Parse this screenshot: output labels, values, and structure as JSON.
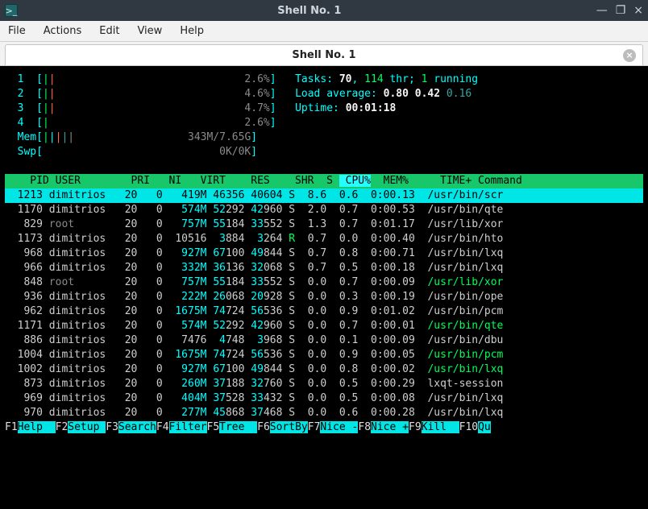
{
  "window": {
    "title": "Shell No. 1",
    "icon_text": ">_",
    "min": "—",
    "max": "❐",
    "close": "×"
  },
  "menu": [
    "File",
    "Actions",
    "Edit",
    "View",
    "Help"
  ],
  "tab": {
    "title": "Shell No. 1",
    "close": "×"
  },
  "cpu": [
    {
      "n": "1",
      "bar": "||",
      "pct": "2.6%"
    },
    {
      "n": "2",
      "bar": "||",
      "pct": "4.6%"
    },
    {
      "n": "3",
      "bar": "||",
      "pct": "4.7%"
    },
    {
      "n": "4",
      "bar": "|",
      "pct": "2.6%"
    }
  ],
  "mem": {
    "label": "Mem",
    "bar": "|||||",
    "val": "343M/7.65G"
  },
  "swp": {
    "label": "Swp",
    "bar": "",
    "val": "0K/0K"
  },
  "stats": {
    "tasks_label": "Tasks:",
    "tasks": "70",
    "thr": "114",
    "thr_label": "thr;",
    "running": "1",
    "running_label": "running",
    "load_label": "Load average:",
    "load1": "0.80",
    "load2": "0.42",
    "load3": "0.16",
    "uptime_label": "Uptime:",
    "uptime": "00:01:18"
  },
  "headers": [
    "PID",
    "USER",
    "PRI",
    "NI",
    "VIRT",
    "RES",
    "SHR",
    "S",
    "CPU%",
    "MEM%",
    "TIME+",
    "Command"
  ],
  "rows": [
    {
      "pid": "1213",
      "user": "dimitrios",
      "pri": "20",
      "ni": "0",
      "virt": "419M",
      "res": "46356",
      "shr": "40604",
      "s": "S",
      "cpu": "8.6",
      "mem": "0.6",
      "time": "0:00.13",
      "cmd": "/usr/bin/scr",
      "sel": true
    },
    {
      "pid": "1170",
      "user": "dimitrios",
      "pri": "20",
      "ni": "0",
      "virt": "574M",
      "res": "52292",
      "shr": "42960",
      "s": "S",
      "cpu": "2.0",
      "mem": "0.7",
      "time": "0:00.53",
      "cmd": "/usr/bin/qte"
    },
    {
      "pid": "829",
      "user": "root",
      "pri": "20",
      "ni": "0",
      "virt": "757M",
      "res": "55184",
      "shr": "33552",
      "s": "S",
      "cpu": "1.3",
      "mem": "0.7",
      "time": "0:01.17",
      "cmd": "/usr/lib/xor",
      "root": true
    },
    {
      "pid": "1173",
      "user": "dimitrios",
      "pri": "20",
      "ni": "0",
      "virt": "10516",
      "res": "3884",
      "shr": "3264",
      "s": "R",
      "cpu": "0.7",
      "mem": "0.0",
      "time": "0:00.40",
      "cmd": "/usr/bin/hto",
      "virt_plain": true,
      "run": true
    },
    {
      "pid": "968",
      "user": "dimitrios",
      "pri": "20",
      "ni": "0",
      "virt": "927M",
      "res": "67100",
      "shr": "49844",
      "s": "S",
      "cpu": "0.7",
      "mem": "0.8",
      "time": "0:00.71",
      "cmd": "/usr/bin/lxq"
    },
    {
      "pid": "966",
      "user": "dimitrios",
      "pri": "20",
      "ni": "0",
      "virt": "332M",
      "res": "36136",
      "shr": "32068",
      "s": "S",
      "cpu": "0.7",
      "mem": "0.5",
      "time": "0:00.18",
      "cmd": "/usr/bin/lxq"
    },
    {
      "pid": "848",
      "user": "root",
      "pri": "20",
      "ni": "0",
      "virt": "757M",
      "res": "55184",
      "shr": "33552",
      "s": "S",
      "cpu": "0.0",
      "mem": "0.7",
      "time": "0:00.09",
      "cmd": "/usr/lib/xor",
      "root": true,
      "cmdgr": true
    },
    {
      "pid": "936",
      "user": "dimitrios",
      "pri": "20",
      "ni": "0",
      "virt": "222M",
      "res": "26068",
      "shr": "20928",
      "s": "S",
      "cpu": "0.0",
      "mem": "0.3",
      "time": "0:00.19",
      "cmd": "/usr/bin/ope"
    },
    {
      "pid": "962",
      "user": "dimitrios",
      "pri": "20",
      "ni": "0",
      "virt": "1675M",
      "res": "74724",
      "shr": "56536",
      "s": "S",
      "cpu": "0.0",
      "mem": "0.9",
      "time": "0:01.02",
      "cmd": "/usr/bin/pcm"
    },
    {
      "pid": "1171",
      "user": "dimitrios",
      "pri": "20",
      "ni": "0",
      "virt": "574M",
      "res": "52292",
      "shr": "42960",
      "s": "S",
      "cpu": "0.0",
      "mem": "0.7",
      "time": "0:00.01",
      "cmd": "/usr/bin/qte",
      "cmdgr": true
    },
    {
      "pid": "886",
      "user": "dimitrios",
      "pri": "20",
      "ni": "0",
      "virt": "7476",
      "res": "4748",
      "shr": "3968",
      "s": "S",
      "cpu": "0.0",
      "mem": "0.1",
      "time": "0:00.09",
      "cmd": "/usr/bin/dbu",
      "virt_plain": true
    },
    {
      "pid": "1004",
      "user": "dimitrios",
      "pri": "20",
      "ni": "0",
      "virt": "1675M",
      "res": "74724",
      "shr": "56536",
      "s": "S",
      "cpu": "0.0",
      "mem": "0.9",
      "time": "0:00.05",
      "cmd": "/usr/bin/pcm",
      "cmdgr": true
    },
    {
      "pid": "1002",
      "user": "dimitrios",
      "pri": "20",
      "ni": "0",
      "virt": "927M",
      "res": "67100",
      "shr": "49844",
      "s": "S",
      "cpu": "0.0",
      "mem": "0.8",
      "time": "0:00.02",
      "cmd": "/usr/bin/lxq",
      "cmdgr": true
    },
    {
      "pid": "873",
      "user": "dimitrios",
      "pri": "20",
      "ni": "0",
      "virt": "260M",
      "res": "37188",
      "shr": "32760",
      "s": "S",
      "cpu": "0.0",
      "mem": "0.5",
      "time": "0:00.29",
      "cmd": "lxqt-session"
    },
    {
      "pid": "969",
      "user": "dimitrios",
      "pri": "20",
      "ni": "0",
      "virt": "404M",
      "res": "37528",
      "shr": "33432",
      "s": "S",
      "cpu": "0.0",
      "mem": "0.5",
      "time": "0:00.08",
      "cmd": "/usr/bin/lxq"
    },
    {
      "pid": "970",
      "user": "dimitrios",
      "pri": "20",
      "ni": "0",
      "virt": "277M",
      "res": "45868",
      "shr": "37468",
      "s": "S",
      "cpu": "0.0",
      "mem": "0.6",
      "time": "0:00.28",
      "cmd": "/usr/bin/lxq"
    }
  ],
  "fkeys": [
    {
      "k": "F1",
      "n": "Help  "
    },
    {
      "k": "F2",
      "n": "Setup "
    },
    {
      "k": "F3",
      "n": "Search"
    },
    {
      "k": "F4",
      "n": "Filter"
    },
    {
      "k": "F5",
      "n": "Tree  "
    },
    {
      "k": "F6",
      "n": "SortBy"
    },
    {
      "k": "F7",
      "n": "Nice -"
    },
    {
      "k": "F8",
      "n": "Nice +"
    },
    {
      "k": "F9",
      "n": "Kill  "
    },
    {
      "k": "F10",
      "n": "Qu"
    }
  ]
}
